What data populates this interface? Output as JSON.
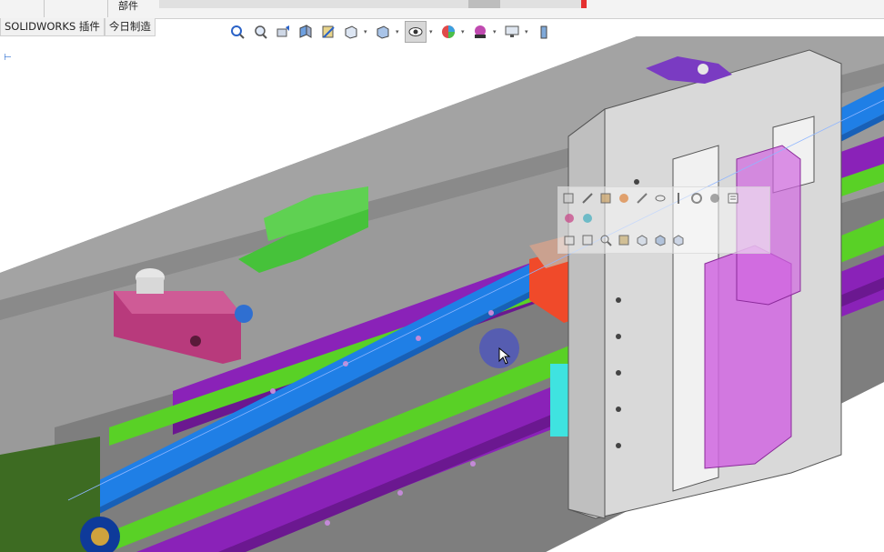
{
  "window": {
    "part_label": "部件"
  },
  "tabs": [
    {
      "label": "SOLIDWORKS 插件"
    },
    {
      "label": "今日制造"
    }
  ],
  "heads_up_toolbar": {
    "buttons": [
      {
        "icon": "zoom-to-fit-icon"
      },
      {
        "icon": "zoom-to-area-icon"
      },
      {
        "icon": "previous-view-icon"
      },
      {
        "icon": "section-view-icon"
      },
      {
        "icon": "dynamic-annotation-icon"
      },
      {
        "icon": "view-orientation-icon"
      },
      {
        "icon": "display-style-icon"
      },
      {
        "icon": "hide-show-items-icon"
      },
      {
        "icon": "edit-appearance-icon"
      },
      {
        "icon": "apply-scene-icon"
      },
      {
        "icon": "view-settings-icon"
      },
      {
        "icon": "render-tools-icon"
      }
    ]
  },
  "context_toolbar": {
    "row1": [
      "edit-component-icon",
      "smart-mate-icon",
      "open-part-icon",
      "appearance-icon",
      "measure-icon",
      "hide-icon",
      "isolate-icon",
      "change-transparency-icon",
      "rebuild-icon",
      "properties-icon"
    ],
    "row2": [
      "component-icon",
      "color-icon"
    ],
    "row3": [
      "edit-sketch-icon",
      "suppress-icon",
      "zoom-to-selection-icon",
      "normal-to-icon",
      "view-orientation-icon",
      "display-pane-icon",
      "pattern-icon"
    ]
  },
  "colors": {
    "model_gray": "#9a9a9a",
    "rail_purple": "#8a22b8",
    "belt_blue": "#1f7fe6",
    "guide_green": "#59d126",
    "block_magenta": "#b83a7c",
    "carriage_pink": "#d066e0",
    "cyan_part": "#3fe3e0",
    "orange_part": "#f04a2a"
  }
}
